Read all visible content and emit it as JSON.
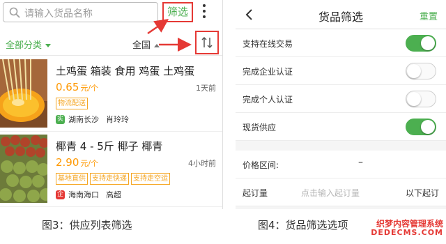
{
  "left_panel": {
    "search": {
      "placeholder": "请输入货品名称"
    },
    "filter_label": "筛选",
    "sort_bar": {
      "category": "全部分类",
      "region": "全国"
    },
    "items": [
      {
        "title": "土鸡蛋 箱装 食用 鸡蛋 土鸡蛋",
        "price": "0.65",
        "unit": "元/个",
        "time": "1天前",
        "tags": [
          "物流配送"
        ],
        "badge": "实",
        "location": "湖南长沙",
        "seller": "肖玲玲"
      },
      {
        "title": "椰青 4 - 5斤 椰子 椰青",
        "price": "2.90",
        "unit": "元/个",
        "time": "4小时前",
        "tags": [
          "基地直供",
          "支持走快递",
          "支持走空运"
        ],
        "badge": "企",
        "location": "海南海口",
        "seller": "高超"
      }
    ]
  },
  "right_panel": {
    "title": "货品筛选",
    "reset_label": "重置",
    "options": [
      {
        "label": "支持在线交易",
        "on": true
      },
      {
        "label": "完成企业认证",
        "on": false
      },
      {
        "label": "完成个人认证",
        "on": false
      },
      {
        "label": "现货供应",
        "on": true
      }
    ],
    "price_range": {
      "label": "价格区间:",
      "separator": "–"
    },
    "moq": {
      "label": "起订量",
      "placeholder": "点击输入起订量",
      "suffix": "以下起订"
    }
  },
  "captions": {
    "left": "图3：供应列表筛选",
    "right": "图4：货品筛选选项"
  },
  "watermark": {
    "line1": "织梦内容管理系统",
    "line2": "DEDECMS.COM"
  },
  "colors": {
    "accent_green": "#4caf50",
    "price_orange": "#ff9800",
    "highlight_red": "#e53935"
  }
}
